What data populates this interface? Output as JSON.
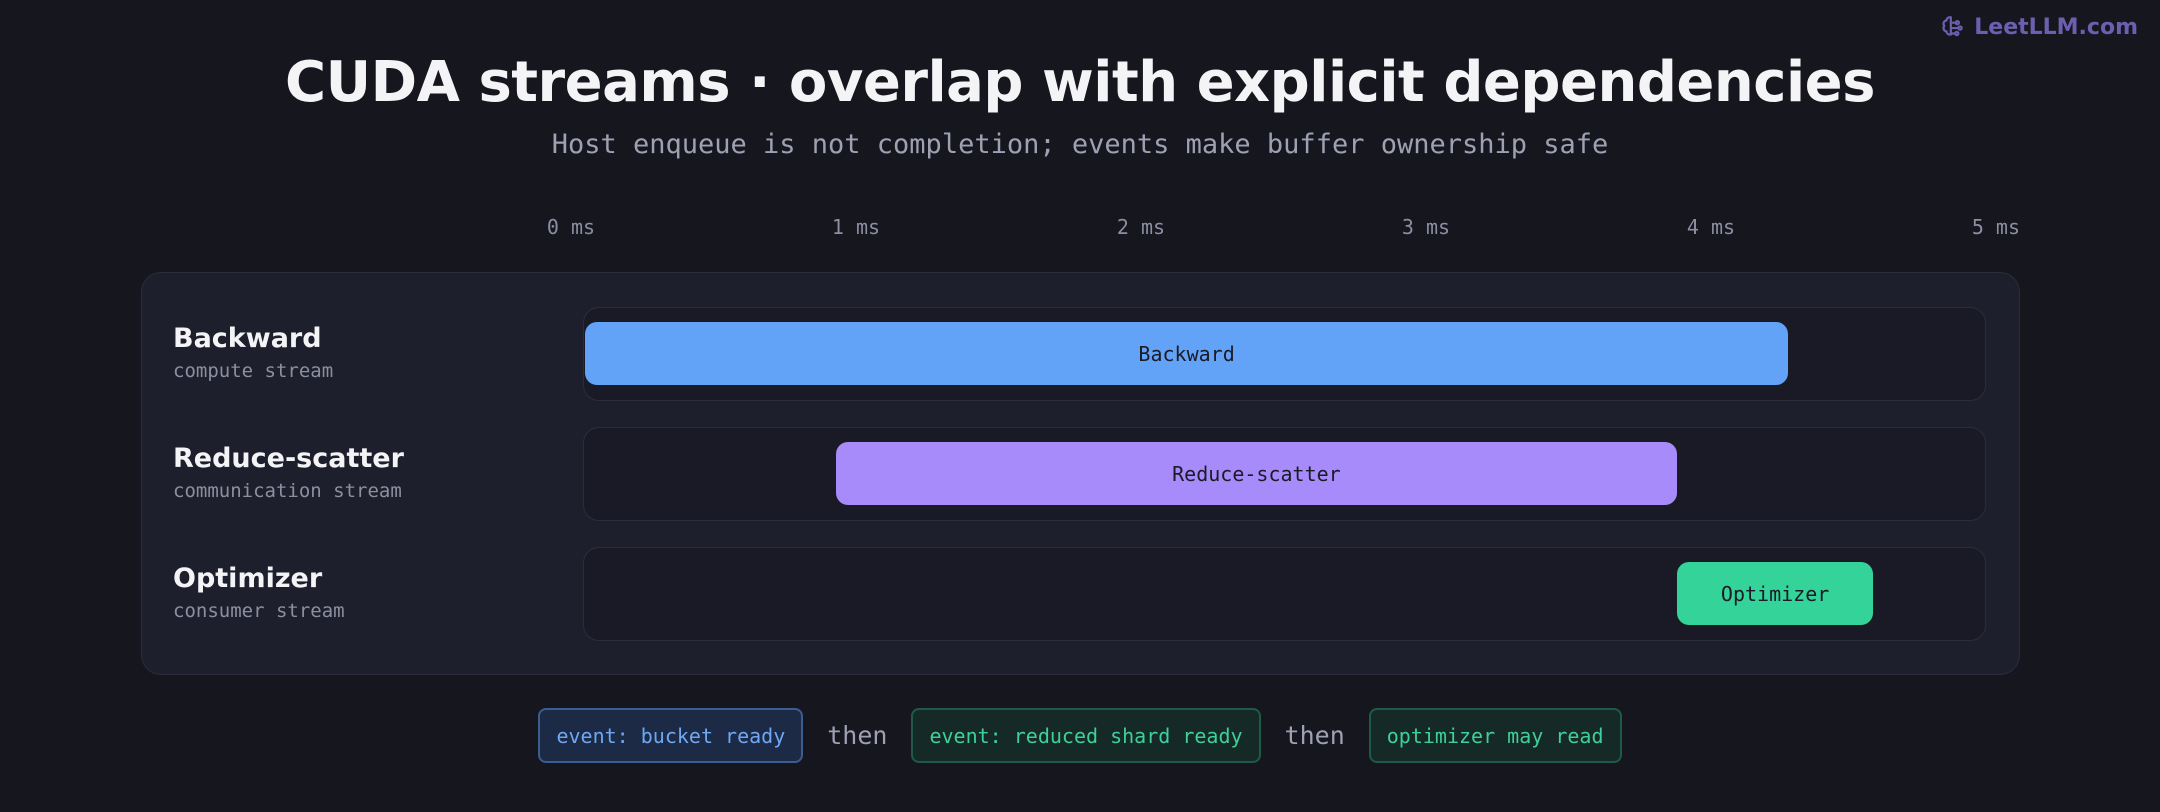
{
  "brand": {
    "text": "LeetLLM.com",
    "icon": "brain-icon",
    "color": "#6d5fb0"
  },
  "title": "CUDA streams · overlap with explicit dependencies",
  "subtitle": "Host enqueue is not completion; events make buffer ownership safe",
  "axis": {
    "unit": "ms",
    "range": [
      0,
      5
    ],
    "ticks": [
      {
        "value": 0,
        "label": "0 ms"
      },
      {
        "value": 1,
        "label": "1 ms"
      },
      {
        "value": 2,
        "label": "2 ms"
      },
      {
        "value": 3,
        "label": "3 ms"
      },
      {
        "value": 4,
        "label": "4 ms"
      },
      {
        "value": 5,
        "label": "5 ms"
      }
    ]
  },
  "streams": [
    {
      "name": "Backward",
      "description": "compute stream",
      "bar_label": "Backward",
      "start_ms": 0.05,
      "end_ms": 4.27,
      "color": "#62a3f8"
    },
    {
      "name": "Reduce-scatter",
      "description": "communication stream",
      "bar_label": "Reduce-scatter",
      "start_ms": 0.93,
      "end_ms": 3.88,
      "color": "#a78bfa"
    },
    {
      "name": "Optimizer",
      "description": "consumer stream",
      "bar_label": "Optimizer",
      "start_ms": 3.88,
      "end_ms": 4.57,
      "color": "#34d399"
    }
  ],
  "legend": {
    "events": [
      {
        "text": "event: bucket ready",
        "style": "blue"
      },
      {
        "text": "event: reduced shard ready",
        "style": "green"
      },
      {
        "text": "optimizer may read",
        "style": "green"
      }
    ],
    "separator": "then"
  }
}
